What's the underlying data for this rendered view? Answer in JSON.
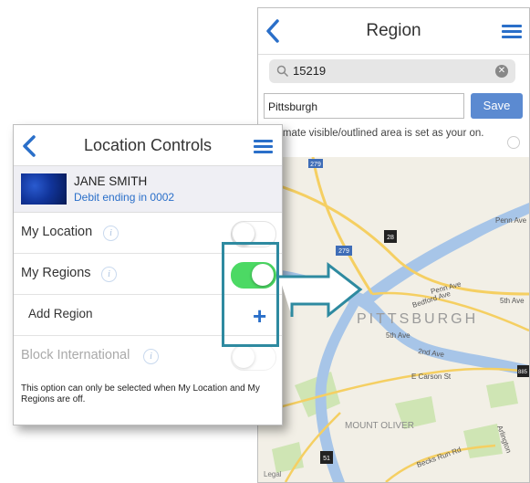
{
  "region_screen": {
    "title": "Region",
    "search_value": "15219",
    "name_value": "Pittsburgh",
    "save_label": "Save",
    "hint_text": "proximate visible/outlined area is set as your on.",
    "map": {
      "labels": {
        "city": "PITTSBURGH",
        "penn_ave": "Penn Ave",
        "penn_ave_right": "Penn Ave",
        "fifth_ave": "5th Ave",
        "fifth_ave_right": "5th Ave",
        "bedford_ave": "Bedford Ave",
        "second_ave": "2nd Ave",
        "e_carson_st": "E Carson St",
        "mount_oliver": "MOUNT OLIVER",
        "becks_run_rd": "Becks Run Rd",
        "arlington": "Arlington"
      },
      "shields": [
        "279",
        "28",
        "279",
        "51",
        "885"
      ],
      "legal": "Legal"
    }
  },
  "location_controls": {
    "title": "Location Controls",
    "card": {
      "name": "JANE SMITH",
      "debit": "Debit ending in 0002"
    },
    "rows": [
      {
        "label": "My Location",
        "toggle": false
      },
      {
        "label": "My Regions",
        "toggle": true
      },
      {
        "label": "Add Region"
      },
      {
        "label": "Block International",
        "toggle": false,
        "disabled": true
      }
    ],
    "note": "This option can only be selected when My Location and My Regions are off."
  },
  "colors": {
    "accent_blue": "#2a6fc9",
    "toggle_on": "#4cd964",
    "callout": "#2e8aa0",
    "save_button": "#5b8ad1"
  }
}
